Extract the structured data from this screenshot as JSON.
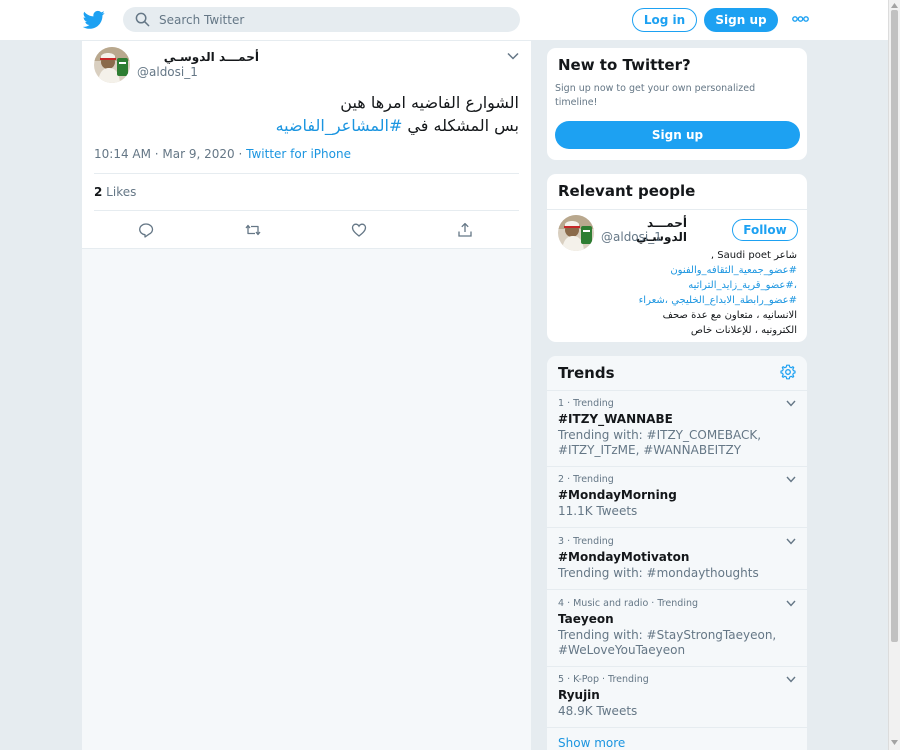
{
  "header": {
    "logo_icon": "twitter-bird-icon",
    "search_placeholder": "Search Twitter",
    "login_label": "Log in",
    "signup_label": "Sign up",
    "more_icon": "more-dots-icon",
    "accent_color": "#1da1f2"
  },
  "tweet": {
    "display_name": "أحمـــد الدوسـي",
    "handle": "@aldosi_1",
    "text_line1": "الشوارع الفاضيه امرها هين",
    "text_line2_prefix": "بس المشكله في ",
    "hashtag": "#المشاعر_الفاضيه",
    "timestamp": "10:14 AM · Mar 9, 2020",
    "separator": " · ",
    "source": "Twitter for iPhone",
    "likes_count": "2",
    "likes_label": " Likes",
    "actions": [
      "reply-icon",
      "retweet-icon",
      "like-icon",
      "share-icon"
    ]
  },
  "new_to_twitter": {
    "title": "New to Twitter?",
    "subtitle": "Sign up now to get your own personalized timeline!",
    "button": "Sign up"
  },
  "relevant_people": {
    "title": "Relevant people",
    "name": "أحمـــد الدوسـي",
    "handle": "@aldosi_1",
    "follow_label": "Follow",
    "bio_lines": [
      "شاعر Saudi poet ,",
      "#عضو_جمعية_الثقافه_والفنون",
      "،#عضو_قرية_زايد_التراثيه",
      "#عضو_رابطة_الابداع_الخليجي ،شعراء",
      "الانسانيه ، متعاون مع عدة صحف",
      "الكترونيه ، للإعلانات خاص"
    ]
  },
  "trends": {
    "title": "Trends",
    "settings_icon": "gear-icon",
    "items": [
      {
        "meta": "1 · Trending",
        "name": "#ITZY_WANNABE",
        "sub": "Trending with: #ITZY_COMEBACK, #ITZY_ITzME, #WANNABEITZY"
      },
      {
        "meta": "2 · Trending",
        "name": "#MondayMorning",
        "sub": "11.1K Tweets"
      },
      {
        "meta": "3 · Trending",
        "name": "#MondayMotivaton",
        "sub": "Trending with: #mondaythoughts"
      },
      {
        "meta": "4 · Music and radio · Trending",
        "name": "Taeyeon",
        "sub": "Trending with: #StayStrongTaeyeon, #WeLoveYouTaeyeon"
      },
      {
        "meta": "5 · K-Pop · Trending",
        "name": "Ryujin",
        "sub": "48.9K Tweets"
      }
    ],
    "show_more": "Show more"
  }
}
